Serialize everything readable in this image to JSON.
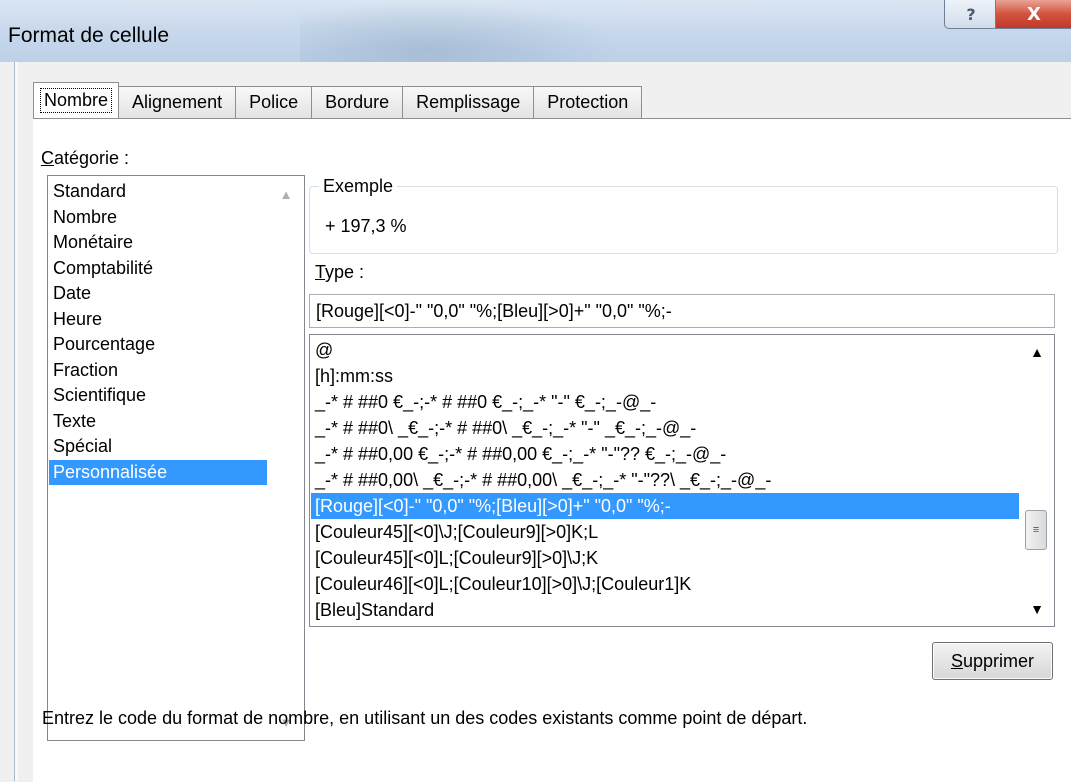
{
  "window": {
    "title": "Format de cellule",
    "help_glyph": "?",
    "close_glyph": "X"
  },
  "tabs": [
    {
      "label": "Nombre",
      "active": true
    },
    {
      "label": "Alignement"
    },
    {
      "label": "Police"
    },
    {
      "label": "Bordure"
    },
    {
      "label": "Remplissage"
    },
    {
      "label": "Protection"
    }
  ],
  "category": {
    "label_first": "C",
    "label_rest": "atégorie :",
    "items": [
      "Standard",
      "Nombre",
      "Monétaire",
      "Comptabilité",
      "Date",
      "Heure",
      "Pourcentage",
      "Fraction",
      "Scientifique",
      "Texte",
      "Spécial",
      "Personnalisée"
    ],
    "selected": "Personnalisée"
  },
  "exemple": {
    "title": "Exemple",
    "value": "+ 197,3 %"
  },
  "type": {
    "label_first": "T",
    "label_rest": "ype :",
    "value": "[Rouge][<0]-\" \"0,0\" \"%;[Bleu][>0]+\" \"0,0\" \"%;-",
    "formats": [
      "@",
      "[h]:mm:ss",
      "_-* # ##0 €_-;-* # ##0 €_-;_-* \"-\" €_-;_-@_-",
      "_-* # ##0\\ _€_-;-* # ##0\\ _€_-;_-* \"-\" _€_-;_-@_-",
      "_-* # ##0,00 €_-;-* # ##0,00 €_-;_-* \"-\"?? €_-;_-@_-",
      "_-* # ##0,00\\ _€_-;-* # ##0,00\\ _€_-;_-* \"-\"??\\ _€_-;_-@_-",
      "[Rouge][<0]-\" \"0,0\" \"%;[Bleu][>0]+\" \"0,0\" \"%;-",
      "[Couleur45][<0]\\J;[Couleur9][>0]K;L",
      "[Couleur45][<0]L;[Couleur9][>0]\\J;K",
      "[Couleur46][<0]L;[Couleur10][>0]\\J;[Couleur1]K",
      "[Bleu]Standard"
    ],
    "selected_index": 6
  },
  "buttons": {
    "delete_first": "S",
    "delete_rest": "upprimer"
  },
  "help_text": "Entrez le code du format de nombre, en utilisant un des codes existants comme point de départ."
}
